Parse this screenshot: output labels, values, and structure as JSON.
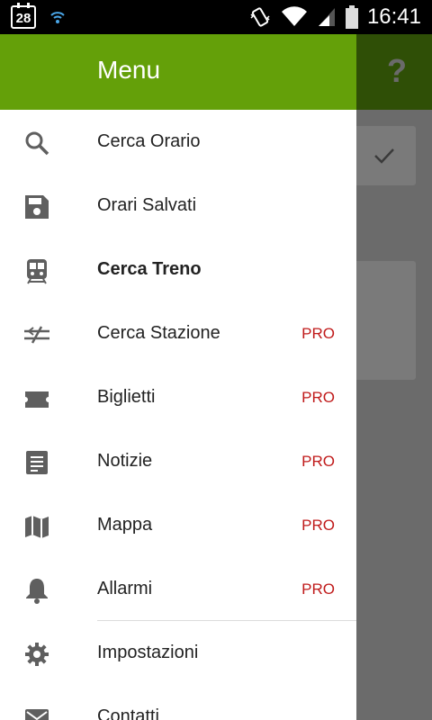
{
  "status_bar": {
    "date_day": "28",
    "time": "16:41"
  },
  "drawer": {
    "title": "Menu",
    "items": [
      {
        "label": "Cerca Orario",
        "icon": "search-icon",
        "pro": ""
      },
      {
        "label": "Orari Salvati",
        "icon": "save-icon",
        "pro": ""
      },
      {
        "label": "Cerca Treno",
        "icon": "train-icon",
        "pro": "",
        "selected": true
      },
      {
        "label": "Cerca Stazione",
        "icon": "station-icon",
        "pro": "PRO"
      },
      {
        "label": "Biglietti",
        "icon": "ticket-icon",
        "pro": "PRO"
      },
      {
        "label": "Notizie",
        "icon": "news-icon",
        "pro": "PRO"
      },
      {
        "label": "Mappa",
        "icon": "map-icon",
        "pro": "PRO"
      },
      {
        "label": "Allarmi",
        "icon": "bell-icon",
        "pro": "PRO"
      },
      {
        "label": "Impostazioni",
        "icon": "gear-icon",
        "pro": ""
      },
      {
        "label": "Contatti",
        "icon": "mail-icon",
        "pro": ""
      }
    ]
  },
  "background": {
    "help_label": "?"
  },
  "colors": {
    "header_green": "#64a009",
    "pro_red": "#c01a1a",
    "icon_gray": "#5f5f5f"
  }
}
